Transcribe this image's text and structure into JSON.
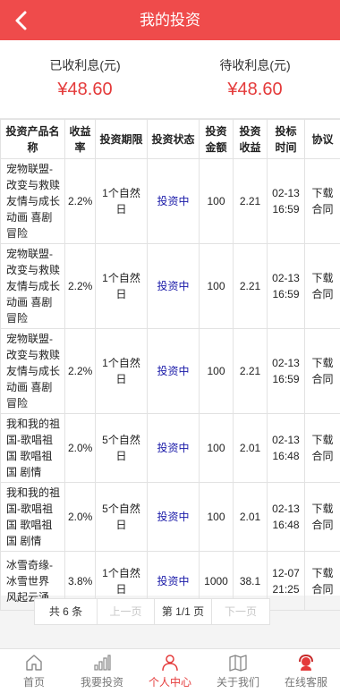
{
  "header": {
    "title": "我的投资"
  },
  "summary": {
    "received_label": "已收利息(元)",
    "received_value": "¥48.60",
    "pending_label": "待收利息(元)",
    "pending_value": "¥48.60"
  },
  "table": {
    "headers": [
      "投资产品名称",
      "收益率",
      "投资期限",
      "投资状态",
      "投资金额",
      "投资收益",
      "投标时间",
      "协议"
    ],
    "rows": [
      {
        "name": "宠物联盟-改变与救赎 友情与成长 动画 喜剧 冒险",
        "rate": "2.2%",
        "term": "1个自然日",
        "status": "投资中",
        "amount": "100",
        "income": "2.21",
        "time": "02-13 16:59",
        "agreement": "下载合同"
      },
      {
        "name": "宠物联盟-改变与救赎 友情与成长 动画 喜剧 冒险",
        "rate": "2.2%",
        "term": "1个自然日",
        "status": "投资中",
        "amount": "100",
        "income": "2.21",
        "time": "02-13 16:59",
        "agreement": "下载合同"
      },
      {
        "name": "宠物联盟-改变与救赎 友情与成长 动画 喜剧 冒险",
        "rate": "2.2%",
        "term": "1个自然日",
        "status": "投资中",
        "amount": "100",
        "income": "2.21",
        "time": "02-13 16:59",
        "agreement": "下载合同"
      },
      {
        "name": "我和我的祖国-歌唱祖国 歌唱祖国 剧情",
        "rate": "2.0%",
        "term": "5个自然日",
        "status": "投资中",
        "amount": "100",
        "income": "2.01",
        "time": "02-13 16:48",
        "agreement": "下载合同"
      },
      {
        "name": "我和我的祖国-歌唱祖国 歌唱祖国 剧情",
        "rate": "2.0%",
        "term": "5个自然日",
        "status": "投资中",
        "amount": "100",
        "income": "2.01",
        "time": "02-13 16:48",
        "agreement": "下载合同"
      },
      {
        "name": "冰雪奇缘-冰雪世界 风起云涌",
        "rate": "3.8%",
        "term": "1个自然日",
        "status": "投资中",
        "amount": "1000",
        "income": "38.1",
        "time": "12-07 21:25",
        "agreement": "下载合同"
      }
    ]
  },
  "pager": {
    "total": "共 6 条",
    "prev": "上一页",
    "current": "第 1/1 页",
    "next": "下一页"
  },
  "tabbar": {
    "items": [
      {
        "label": "首页",
        "icon": "home-icon"
      },
      {
        "label": "我要投资",
        "icon": "bar-chart-icon"
      },
      {
        "label": "个人中心",
        "icon": "user-icon"
      },
      {
        "label": "关于我们",
        "icon": "map-icon"
      },
      {
        "label": "在线客服",
        "icon": "support-icon"
      }
    ],
    "active_index": 2
  },
  "colors": {
    "header_bg": "#ef4b4b",
    "accent": "#e43a3a",
    "status_text": "#1a1aa8"
  }
}
